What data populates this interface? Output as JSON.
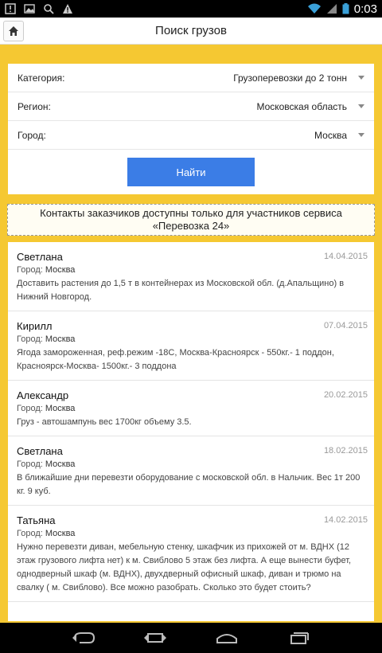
{
  "status_bar": {
    "time": "0:03"
  },
  "app_bar": {
    "title": "Поиск грузов"
  },
  "filters": [
    {
      "label": "Категория:",
      "value": "Грузоперевозки до 2 тонн"
    },
    {
      "label": "Регион:",
      "value": "Московская область"
    },
    {
      "label": "Город:",
      "value": "Москва"
    }
  ],
  "search_button": {
    "label": "Найти"
  },
  "notice": "Контакты заказчиков доступны только для участников сервиса «Перевозка 24»",
  "city_prefix": "Город:",
  "orders": [
    {
      "name": "Светлана",
      "date": "14.04.2015",
      "city": "Москва",
      "desc": "Доставить растения до 1,5 т в контейнерах из Московской обл. (д.Апальщино) в Нижний Новгород."
    },
    {
      "name": "Кирилл",
      "date": "07.04.2015",
      "city": "Москва",
      "desc": "Ягода замороженная, реф.режим -18С, Москва-Красноярск - 550кг.- 1 поддон, Красноярск-Москва- 1500кг.- 3 поддона"
    },
    {
      "name": "Александр",
      "date": "20.02.2015",
      "city": "Москва",
      "desc": "Груз - автошампунь вес 1700кг объему 3.5."
    },
    {
      "name": "Светлана",
      "date": "18.02.2015",
      "city": "Москва",
      "desc": "В ближайшие дни перевезти оборудование с московской обл. в Нальчик. Вес 1т 200 кг. 9 куб."
    },
    {
      "name": "Татьяна",
      "date": "14.02.2015",
      "city": "Москва",
      "desc": "Нужно перевезти диван, мебельную стенку, шкафчик из прихожей от м. ВДНХ (12 этаж грузового лифта нет) к м. Свиблово 5 этаж без лифта. А еще вынести буфет, однодверный шкаф (м. ВДНХ), двухдверный офисный шкаф, диван и трюмо на свалку ( м. Свиблово). Все можно разобрать. Сколько это будет стоить?"
    }
  ],
  "colors": {
    "background": "#f5c832",
    "button": "#3b7de6"
  },
  "icons": [
    "home-icon",
    "back-icon",
    "home-nav-icon",
    "recents-icon",
    "wifi-icon",
    "signal-icon",
    "battery-icon"
  ]
}
